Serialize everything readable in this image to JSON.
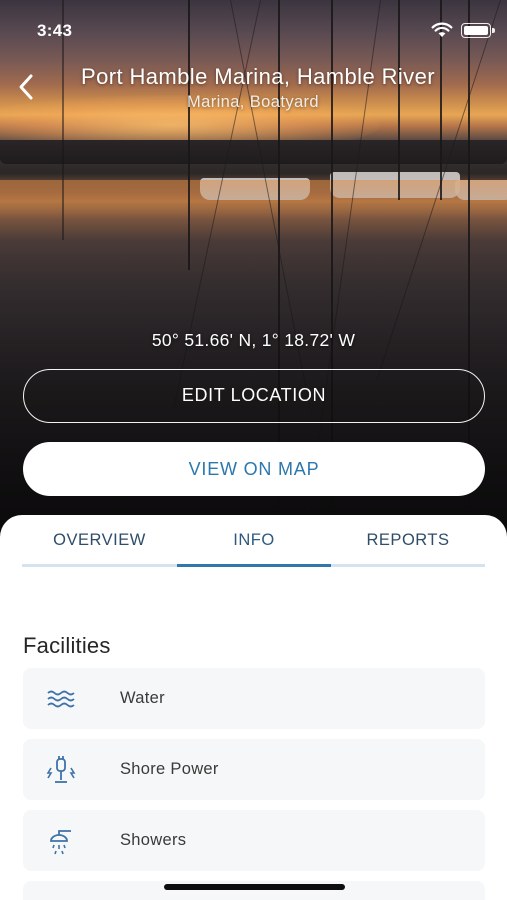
{
  "status_bar": {
    "time": "3:43",
    "wifi_icon": "wifi-icon",
    "battery_icon": "battery-icon"
  },
  "header": {
    "back_icon": "chevron-left-icon",
    "title": "Port Hamble Marina, Hamble River",
    "subtitle": "Marina, Boatyard"
  },
  "location": {
    "coordinates": "50° 51.66' N, 1° 18.72' W",
    "edit_button_label": "EDIT LOCATION",
    "map_button_label": "VIEW ON MAP"
  },
  "tabs": [
    {
      "label": "OVERVIEW",
      "active": false
    },
    {
      "label": "INFO",
      "active": true
    },
    {
      "label": "REPORTS",
      "active": false
    }
  ],
  "facilities": {
    "title": "Facilities",
    "items": [
      {
        "label": "Water",
        "icon": "water-icon"
      },
      {
        "label": "Shore Power",
        "icon": "shore-power-icon"
      },
      {
        "label": "Showers",
        "icon": "shower-icon"
      }
    ]
  },
  "colors": {
    "accent": "#2f77ad",
    "tab_text": "#2f4d68",
    "card_bg": "#f6f7f8"
  }
}
